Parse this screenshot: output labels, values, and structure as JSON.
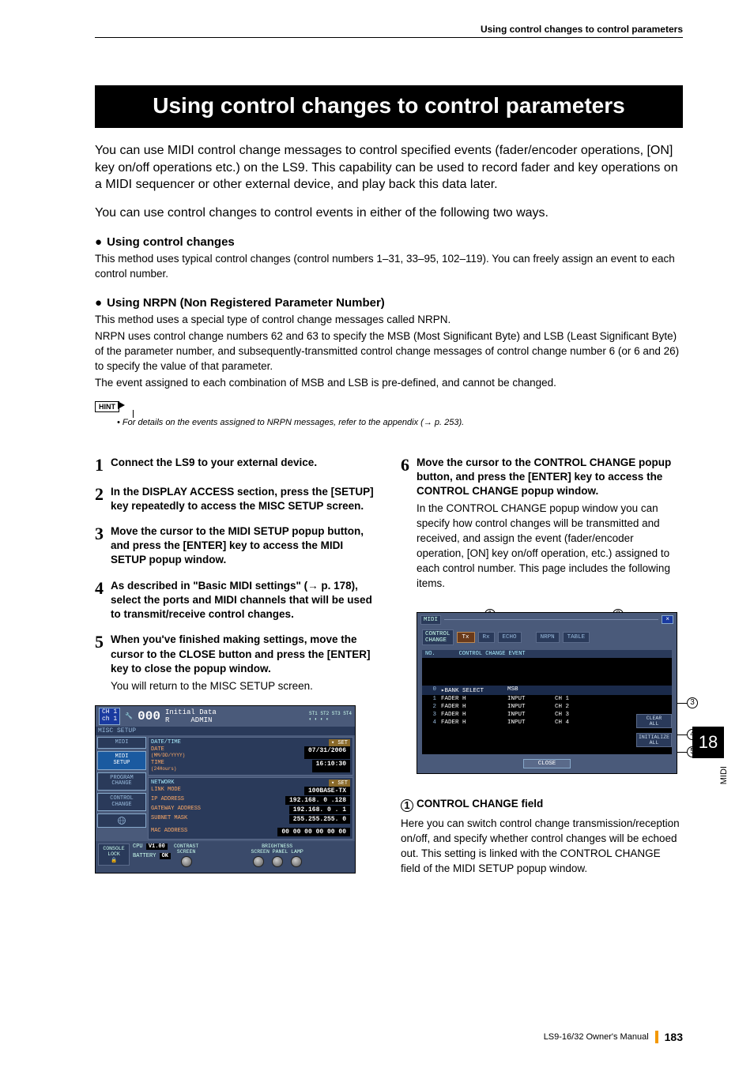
{
  "header": {
    "running": "Using control changes to control parameters"
  },
  "title": "Using control changes to control parameters",
  "intro1": "You can use MIDI control change messages to control specified events (fader/encoder operations, [ON] key on/off operations etc.) on the LS9. This capability can be used to record fader and key operations on a MIDI sequencer or other external device, and play back this data later.",
  "intro2": "You can use control changes to control events in either of the following two ways.",
  "sec1": {
    "h": "Using control changes",
    "p": "This method uses typical control changes (control numbers 1–31, 33–95, 102–119). You can freely assign an event to each control number."
  },
  "sec2": {
    "h": "Using NRPN (Non Registered Parameter Number)",
    "p1": "This method uses a special type of control change messages called NRPN.",
    "p2": "NRPN uses control change numbers 62 and 63 to specify the MSB (Most Significant Byte) and LSB (Least Significant Byte) of the parameter number, and subsequently-transmitted control change messages of control change number 6 (or 6 and 26) to specify the value of that parameter.",
    "p3": "The event assigned to each combination of MSB and LSB is pre-defined, and cannot be changed."
  },
  "hint": {
    "label": "HINT",
    "text": "• For details on the events assigned to NRPN messages, refer to the appendix (→ p. 253)."
  },
  "steps": [
    {
      "n": "1",
      "t": "Connect the LS9 to your external device."
    },
    {
      "n": "2",
      "t": "In the DISPLAY ACCESS section, press the [SETUP] key repeatedly to access the MISC SETUP screen."
    },
    {
      "n": "3",
      "t": "Move the cursor to the MIDI SETUP popup button, and press the [ENTER] key to access the MIDI SETUP popup window."
    },
    {
      "n": "4",
      "t": "As described in \"Basic MIDI settings\" (→ p. 178), select the ports and MIDI channels that will be used to transmit/receive control changes."
    },
    {
      "n": "5",
      "t": "When you've finished making settings, move the cursor to the CLOSE button and press the [ENTER] key to close the popup window.",
      "s": "You will return to the MISC SETUP screen."
    }
  ],
  "step6": {
    "n": "6",
    "t": "Move the cursor to the CONTROL CHANGE popup button, and press the [ENTER] key to access the CONTROL CHANGE popup window.",
    "s": "In the CONTROL CHANGE popup window you can specify how control changes will be transmitted and received, and assign the event (fader/encoder operation, [ON] key on/off operation, etc.) assigned to each control number. This page includes the following items."
  },
  "misc": {
    "tab": "MISC SETUP",
    "ch_top": "CH 1",
    "ch_bot": "ch 1",
    "num": "000",
    "initial": "Initial Data",
    "r": "R",
    "admin": "ADMIN",
    "st": "ST1 ST2 ST3 ST4",
    "side": {
      "midi": "MIDI",
      "midi_setup": "MIDI\nSETUP",
      "prog": "PROGRAM\nCHANGE",
      "ctrl": "CONTROL\nCHANGE"
    },
    "dt": {
      "h": "DATE/TIME",
      "date_l": "DATE",
      "date_f": "(MM/DD/YYYY)",
      "date_v": "07/31/2006",
      "time_l": "TIME",
      "time_f": "(24Hours)",
      "time_v": "16:10:30",
      "set": "▾ SET"
    },
    "net": {
      "h": "NETWORK",
      "set": "▾ SET",
      "link_l": "LINK MODE",
      "link_v": "100BASE-TX",
      "ip_l": "IP ADDRESS",
      "ip_v": "192.168. 0 .128",
      "gw_l": "GATEWAY ADDRESS",
      "gw_v": "192.168. 0 . 1",
      "sm_l": "SUBNET MASK",
      "sm_v": "255.255.255. 0",
      "mac_l": "MAC ADDRESS",
      "mac_v": "00 00 00 00 00 00"
    },
    "bottom": {
      "console": "CONSOLE\nLOCK",
      "cpu": "CPU",
      "cpu_v": "V1.00",
      "bat": "BATTERY",
      "bat_v": "OK",
      "contrast": "CONTRAST",
      "screen": "SCREEN",
      "brightness": "BRIGHTNESS",
      "brightness_labels": "SCREEN PANEL LAMP"
    }
  },
  "cc": {
    "midi": "MIDI",
    "x": "×",
    "label": "CONTROL\nCHANGE",
    "tx": "Tx",
    "rx": "Rx",
    "echo": "ECHO",
    "nrpn": "NRPN",
    "table": "TABLE",
    "th_no": "NO.",
    "th_evt": "CONTROL CHANGE EVENT",
    "rows": [
      {
        "n": "0",
        "e": "▸BANK SELECT",
        "t": "MSB",
        "c": ""
      },
      {
        "n": "1",
        "e": "FADER H",
        "t": "INPUT",
        "c": "CH 1"
      },
      {
        "n": "2",
        "e": "FADER H",
        "t": "INPUT",
        "c": "CH 2"
      },
      {
        "n": "3",
        "e": "FADER H",
        "t": "INPUT",
        "c": "CH 3"
      },
      {
        "n": "4",
        "e": "FADER H",
        "t": "INPUT",
        "c": "CH 4"
      }
    ],
    "clear": "CLEAR\nALL",
    "init": "INITIALIZE\nALL",
    "close": "CLOSE"
  },
  "field1": {
    "num": "1",
    "h": "CONTROL CHANGE field",
    "p": "Here you can switch control change transmission/reception on/off, and specify whether control changes will be echoed out. This setting is linked with the CONTROL CHANGE field of the MIDI SETUP popup window."
  },
  "side": {
    "chapter": "18",
    "label": "MIDI"
  },
  "footer": {
    "owner": "LS9-16/32  Owner's Manual",
    "page": "183"
  }
}
